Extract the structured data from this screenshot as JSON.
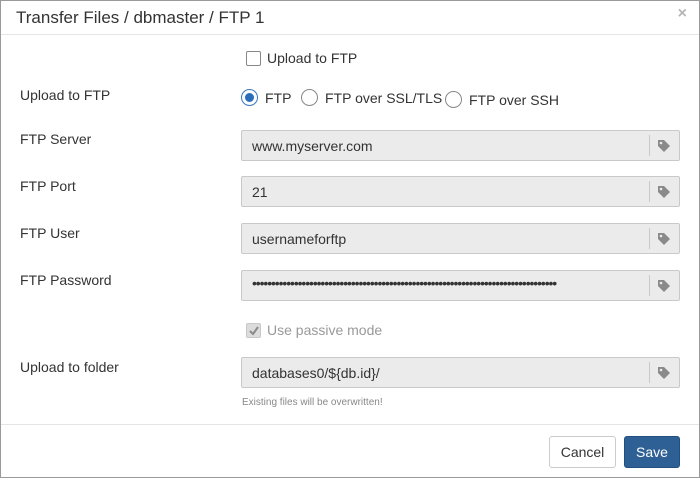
{
  "dialog": {
    "title": "Transfer Files / dbmaster / FTP 1",
    "close_glyph": "×"
  },
  "upload_checkbox": {
    "label": "Upload to FTP",
    "checked": false
  },
  "protocol": {
    "label": "Upload to FTP",
    "options": [
      "FTP",
      "FTP over SSL/TLS",
      "FTP over SSH"
    ],
    "selected": "FTP"
  },
  "fields": {
    "server": {
      "label": "FTP Server",
      "value": "www.myserver.com"
    },
    "port": {
      "label": "FTP Port",
      "value": "21"
    },
    "user": {
      "label": "FTP User",
      "value": "usernameforftp"
    },
    "password": {
      "label": "FTP Password",
      "value": "••••••••••••••••••••••••••••••••••••••••••••••••••••••••••••••••••••••••••••••••"
    },
    "folder": {
      "label": "Upload to folder",
      "value": "databases0/${db.id}/"
    }
  },
  "passive_mode": {
    "label": "Use passive mode",
    "checked": true,
    "disabled": true
  },
  "hint": "Existing files will be overwritten!",
  "buttons": {
    "cancel": "Cancel",
    "save": "Save"
  },
  "icons": {
    "tag": "tag-icon",
    "close": "close-icon",
    "check": "check-icon"
  },
  "colors": {
    "primary": "#2e6095",
    "radio_selected": "#2a6ebb",
    "field_bg": "#ebebeb"
  }
}
